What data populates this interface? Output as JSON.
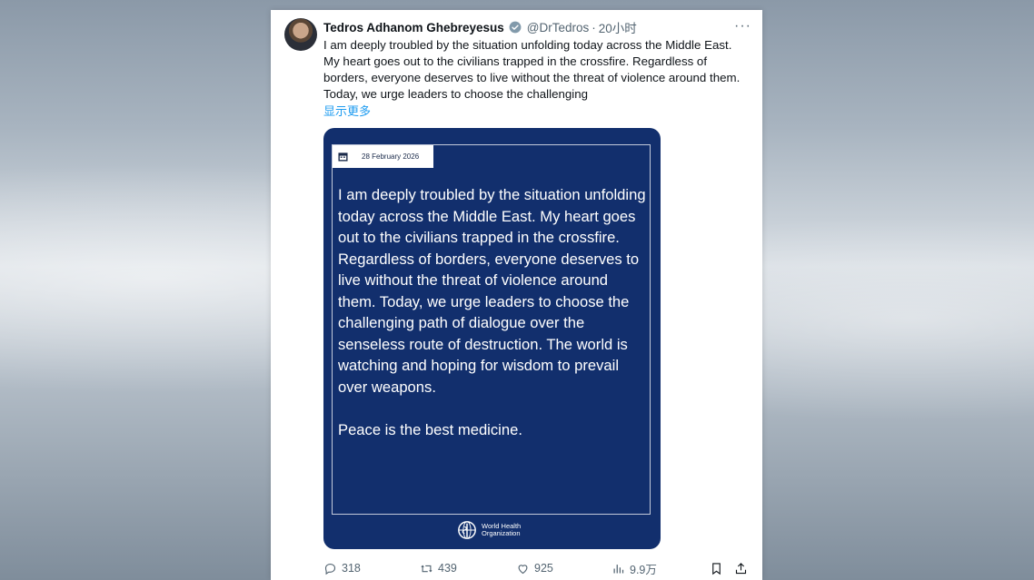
{
  "tweet": {
    "author_name": "Tedros Adhanom Ghebreyesus",
    "handle": "@DrTedros",
    "separator": "·",
    "time": "20小时",
    "more": "···",
    "text": "I am deeply troubled by the situation unfolding today across the Middle East. My heart goes out to the civilians trapped in the crossfire. Regardless of borders, everyone deserves to live without the threat of violence around them. Today, we urge leaders to choose the challenging",
    "show_more": "显示更多"
  },
  "media": {
    "date": "28 February 2026",
    "quote": "I am deeply troubled by the situation unfolding today across the Middle East. My heart goes out to the civilians trapped in the crossfire. Regardless of borders, everyone deserves to live without the threat of violence around them. Today, we urge leaders to choose the challenging path of dialogue over the senseless route of destruction. The world is watching and hoping for wisdom to prevail over weapons.\n\nPeace is the best medicine.",
    "org_name": "World Health Organization",
    "background_color": "#122f6d"
  },
  "actions": {
    "replies": "318",
    "retweets": "439",
    "likes": "925",
    "views": "9.9万"
  },
  "icons": [
    "verified-icon",
    "more-icon",
    "calendar-icon",
    "who-logo-icon",
    "reply-icon",
    "retweet-icon",
    "like-icon",
    "views-icon",
    "bookmark-icon",
    "share-icon"
  ]
}
